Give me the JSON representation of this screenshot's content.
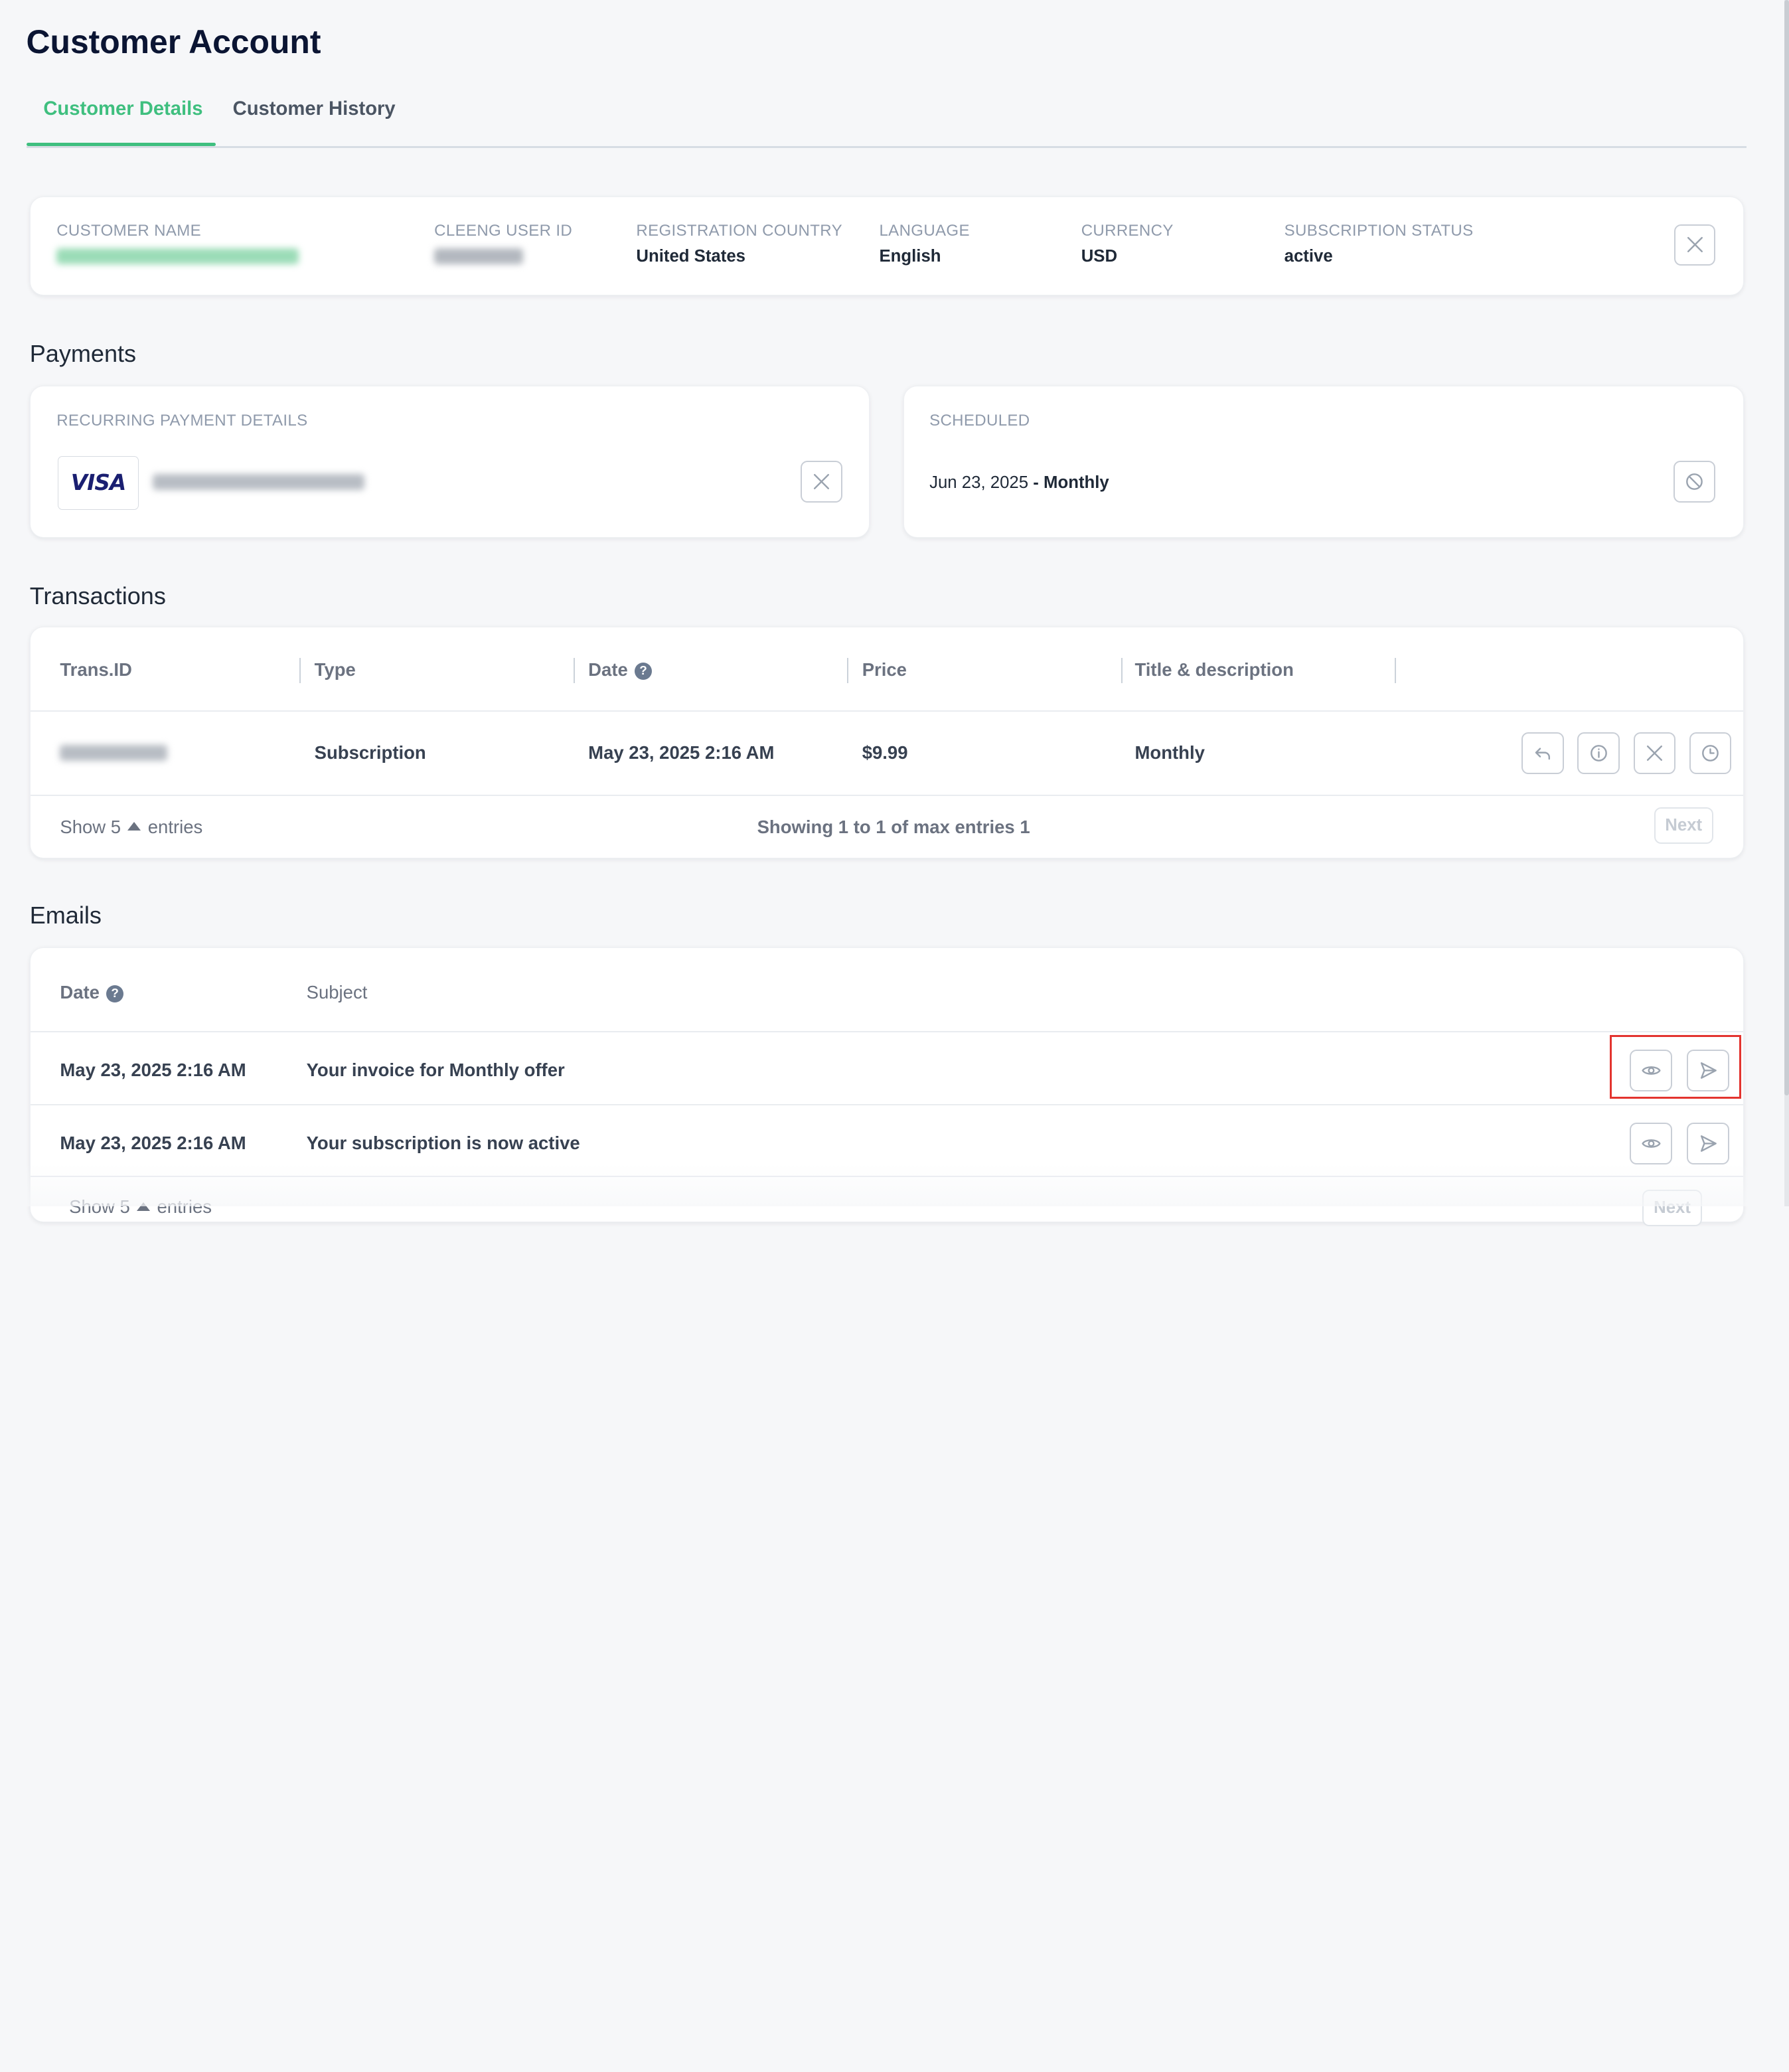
{
  "page_title": "Customer Account",
  "tabs": [
    {
      "label": "Customer Details",
      "active": true
    },
    {
      "label": "Customer History",
      "active": false
    }
  ],
  "customer": {
    "name_label": "CUSTOMER NAME",
    "user_id_label": "CLEENG USER ID",
    "country_label": "REGISTRATION COUNTRY",
    "country_value": "United States",
    "language_label": "LANGUAGE",
    "language_value": "English",
    "currency_label": "CURRENCY",
    "currency_value": "USD",
    "status_label": "SUBSCRIPTION STATUS",
    "status_value": "active"
  },
  "payments": {
    "section_title": "Payments",
    "recurring_label": "RECURRING PAYMENT DETAILS",
    "card_brand": "VISA",
    "scheduled_label": "SCHEDULED",
    "scheduled_date": "Jun 23, 2025",
    "scheduled_separator": " - ",
    "scheduled_period": "Monthly"
  },
  "transactions": {
    "section_title": "Transactions",
    "columns": [
      "Trans.ID",
      "Type",
      "Date",
      "Price",
      "Title & description"
    ],
    "help_glyph": "?",
    "rows": [
      {
        "type": "Subscription",
        "date": "May 23, 2025 2:16 AM",
        "price": "$9.99",
        "title": "Monthly"
      }
    ],
    "footer": {
      "show": "Show 5",
      "entries": "entries",
      "showing": "Showing 1 to 1 of max entries 1",
      "next": "Next"
    }
  },
  "emails": {
    "section_title": "Emails",
    "columns": [
      "Date",
      "Subject"
    ],
    "help_glyph": "?",
    "rows": [
      {
        "date": "May 23, 2025 2:16 AM",
        "subject": "Your invoice for Monthly offer"
      },
      {
        "date": "May 23, 2025 2:16 AM",
        "subject": "Your subscription is now active"
      }
    ],
    "footer": {
      "show": "Show 5",
      "entries": "entries",
      "next": "Next"
    }
  },
  "colors": {
    "accent": "#3fbf7f",
    "highlight": "#e3342f",
    "visa": "#1a1f71"
  }
}
